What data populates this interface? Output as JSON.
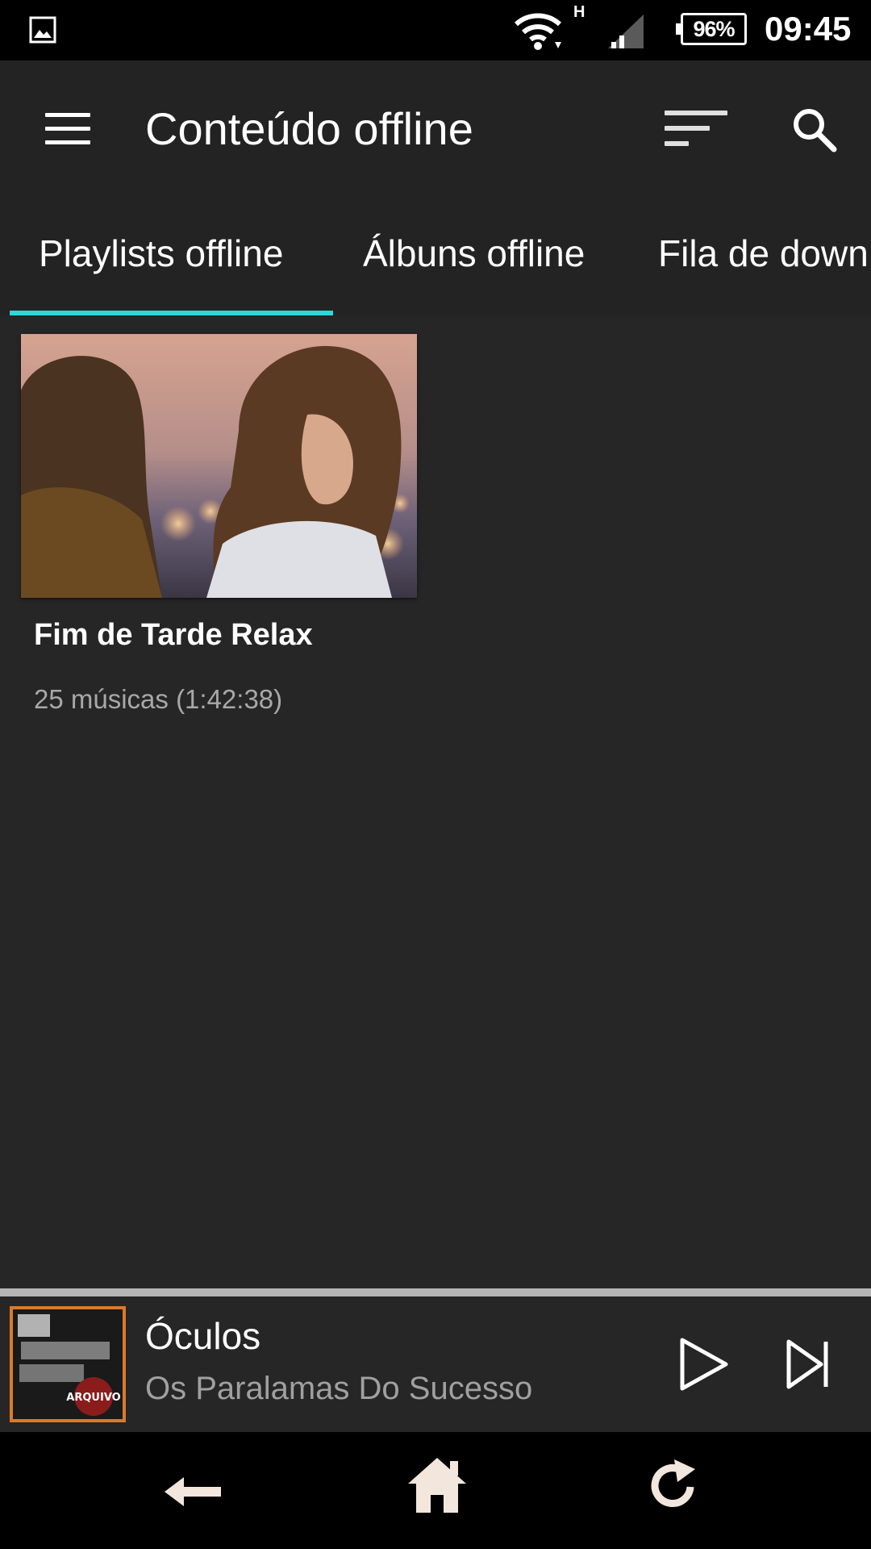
{
  "status_bar": {
    "network_type": "H",
    "battery": "96%",
    "time": "09:45"
  },
  "toolbar": {
    "title": "Conteúdo offline",
    "menu_icon": "hamburger-menu-icon",
    "sort_icon": "sort-icon",
    "search_icon": "search-icon"
  },
  "tabs": [
    {
      "label": "Playlists offline",
      "selected": true
    },
    {
      "label": "Álbuns offline",
      "selected": false
    },
    {
      "label": "Fila de down",
      "selected": false
    }
  ],
  "colors": {
    "accent": "#2ad8d8",
    "background": "#232323",
    "album_border": "#d97a2b"
  },
  "playlists": [
    {
      "title": "Fim de Tarde Relax",
      "subtitle": "25 músicas (1:42:38)"
    }
  ],
  "mini_player": {
    "track_title": "Óculos",
    "artist": "Os Paralamas Do Sucesso",
    "album_art_text": "ARQUIVO",
    "play_icon": "play-icon",
    "next_icon": "skip-next-icon"
  },
  "nav_bar": {
    "back_icon": "back-icon",
    "home_icon": "home-icon",
    "recent_icon": "recent-apps-icon"
  }
}
